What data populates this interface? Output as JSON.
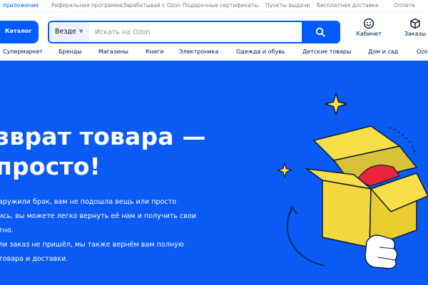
{
  "topbar": {
    "links": [
      "приложение",
      "Реферальная программа",
      "Зарабатывай с Ozon",
      "Подарочные сертификаты",
      "Пункты выдачи",
      "Бесплатная доставка",
      "Оплата"
    ]
  },
  "header": {
    "catalog_label": "Каталог",
    "search": {
      "scope": "Везде",
      "placeholder": "Искать на Ozon",
      "value": ""
    },
    "account": [
      {
        "label": "Кабинет",
        "icon": "smile-icon"
      },
      {
        "label": "Заказы",
        "icon": "box-icon"
      }
    ]
  },
  "nav": {
    "items": [
      "Супермаркет",
      "Бренды",
      "Магазины",
      "Книги",
      "Электроника",
      "Одежда и обувь",
      "Детские товары",
      "Дом и сад",
      "Ozo"
    ]
  },
  "hero": {
    "title_lines": [
      "зврат товара —",
      "просто!"
    ],
    "paragraph_lines": [
      "аружили брак, вам не подошла вещь или просто",
      "ись, вы можете легко вернуть её нам и получить свои",
      "тно.",
      "ли заказ не пришёл, мы также вернём вам полную",
      "товара и доставки."
    ],
    "illustration": "open-box-with-returning-arrow"
  },
  "colors": {
    "brand_blue": "#005bff",
    "hero_blue": "#0a5bf5",
    "box_yellow": "#f7df4a",
    "star_yellow": "#ffe14d"
  }
}
